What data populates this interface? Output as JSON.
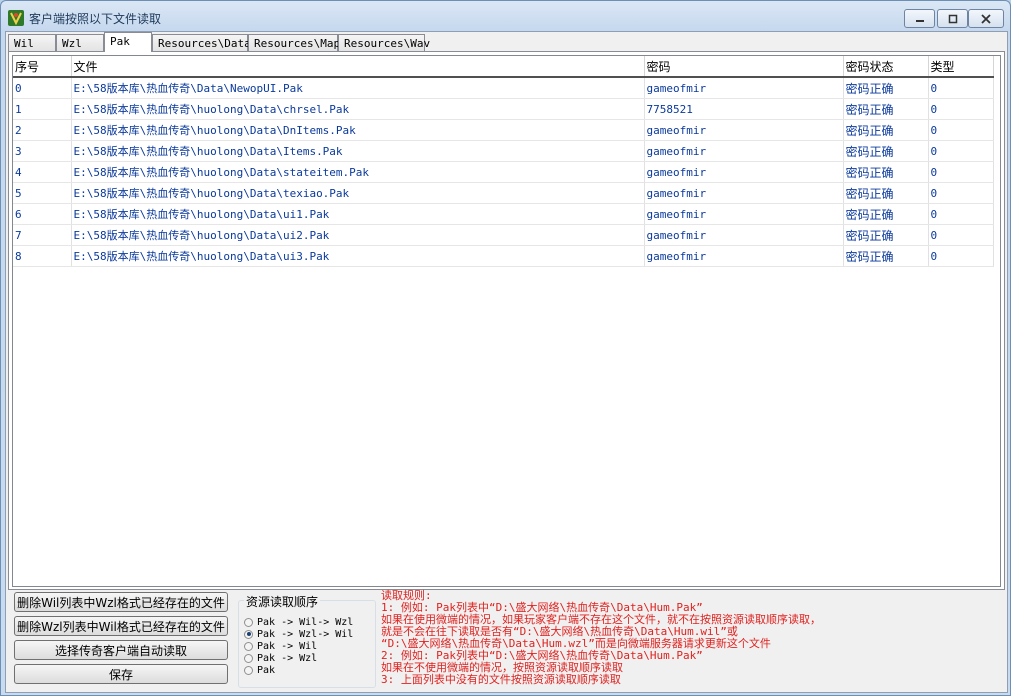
{
  "window": {
    "title": "客户端按照以下文件读取"
  },
  "tabs": [
    "Wil",
    "Wzl",
    "Pak",
    "Resources\\Data",
    "Resources\\Map",
    "Resources\\Wav"
  ],
  "table": {
    "columns": [
      "序号",
      "文件",
      "密码",
      "密码状态",
      "类型"
    ],
    "rows": [
      [
        "0",
        "E:\\58版本库\\热血传奇\\Data\\NewopUI.Pak",
        "gameofmir",
        "密码正确",
        "0"
      ],
      [
        "1",
        "E:\\58版本库\\热血传奇\\huolong\\Data\\chrsel.Pak",
        "7758521",
        "密码正确",
        "0"
      ],
      [
        "2",
        "E:\\58版本库\\热血传奇\\huolong\\Data\\DnItems.Pak",
        "gameofmir",
        "密码正确",
        "0"
      ],
      [
        "3",
        "E:\\58版本库\\热血传奇\\huolong\\Data\\Items.Pak",
        "gameofmir",
        "密码正确",
        "0"
      ],
      [
        "4",
        "E:\\58版本库\\热血传奇\\huolong\\Data\\stateitem.Pak",
        "gameofmir",
        "密码正确",
        "0"
      ],
      [
        "5",
        "E:\\58版本库\\热血传奇\\huolong\\Data\\texiao.Pak",
        "gameofmir",
        "密码正确",
        "0"
      ],
      [
        "6",
        "E:\\58版本库\\热血传奇\\huolong\\Data\\ui1.Pak",
        "gameofmir",
        "密码正确",
        "0"
      ],
      [
        "7",
        "E:\\58版本库\\热血传奇\\huolong\\Data\\ui2.Pak",
        "gameofmir",
        "密码正确",
        "0"
      ],
      [
        "8",
        "E:\\58版本库\\热血传奇\\huolong\\Data\\ui3.Pak",
        "gameofmir",
        "密码正确",
        "0"
      ]
    ]
  },
  "buttons": {
    "delete_wil": "删除Wil列表中Wzl格式已经存在的文件",
    "delete_wzl": "删除Wzl列表中Wil格式已经存在的文件",
    "auto_read": "选择传奇客户端自动读取",
    "save": "保存"
  },
  "order_group": {
    "title": "资源读取顺序",
    "options": [
      "Pak -> Wil-> Wzl",
      "Pak -> Wzl-> Wil",
      "Pak -> Wil",
      "Pak -> Wzl",
      "Pak"
    ],
    "selected": "Pak -> Wzl-> Wil"
  },
  "rules": {
    "lines": [
      "读取规则:",
      "1: 例如: Pak列表中“D:\\盛大网络\\热血传奇\\Data\\Hum.Pak”",
      "    如果在使用微端的情况，如果玩家客户端不存在这个文件，就不在按照资源读取顺序读取，",
      "    就是不会在往下读取是否有“D:\\盛大网络\\热血传奇\\Data\\Hum.wil”或",
      "    “D:\\盛大网络\\热血传奇\\Data\\Hum.wzl”而是向微端服务器请求更新这个文件",
      "2: 例如: Pak列表中“D:\\盛大网络\\热血传奇\\Data\\Hum.Pak”",
      "    如果在不使用微端的情况，按照资源读取顺序读取",
      "3: 上面列表中没有的文件按照资源读取顺序读取"
    ]
  },
  "colors": {
    "link_text": "#0b3a9c",
    "rules_text": "#e0221f"
  }
}
